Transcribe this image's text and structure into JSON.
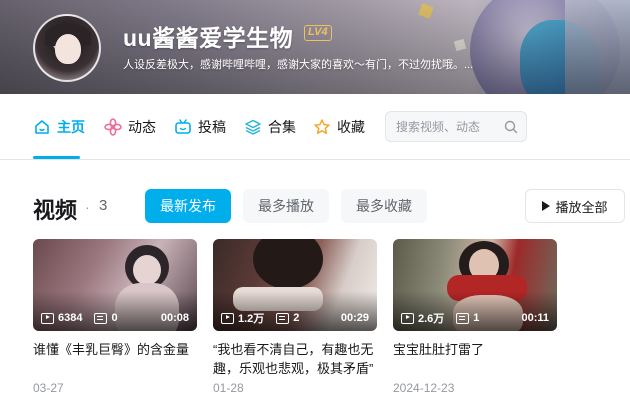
{
  "profile": {
    "username": "uu酱酱爱学生物",
    "level": "LV4",
    "signature": "人设反差极大，感谢哔哩哔哩，感谢大家的喜欢～有门，不过勿扰哦。..."
  },
  "nav": {
    "tabs": [
      {
        "label": "主页",
        "icon": "home-icon",
        "active": true
      },
      {
        "label": "动态",
        "icon": "dynamic-icon",
        "active": false
      },
      {
        "label": "投稿",
        "icon": "tv-icon",
        "active": false
      },
      {
        "label": "合集",
        "icon": "layers-icon",
        "active": false
      },
      {
        "label": "收藏",
        "icon": "star-icon",
        "active": false
      }
    ],
    "search_placeholder": "搜索视频、动态"
  },
  "section": {
    "title": "视频",
    "dot": "·",
    "count": "3",
    "sort_tabs": [
      {
        "label": "最新发布",
        "active": true
      },
      {
        "label": "最多播放",
        "active": false
      },
      {
        "label": "最多收藏",
        "active": false
      }
    ],
    "play_all": "播放全部"
  },
  "videos": [
    {
      "views": "6384",
      "danmaku": "0",
      "duration": "00:08",
      "title": "谁懂《丰乳巨臀》的含金量",
      "date": "03-27"
    },
    {
      "views": "1.2万",
      "danmaku": "2",
      "duration": "00:29",
      "title": "“我也看不清自己，有趣也无趣，乐观也悲观，极其矛盾”",
      "date": "01-28"
    },
    {
      "views": "2.6万",
      "danmaku": "1",
      "duration": "00:11",
      "title": "宝宝肚肚打雷了",
      "date": "2024-12-23"
    }
  ],
  "colors": {
    "accent": "#00aeec",
    "level": "#f0c060"
  }
}
